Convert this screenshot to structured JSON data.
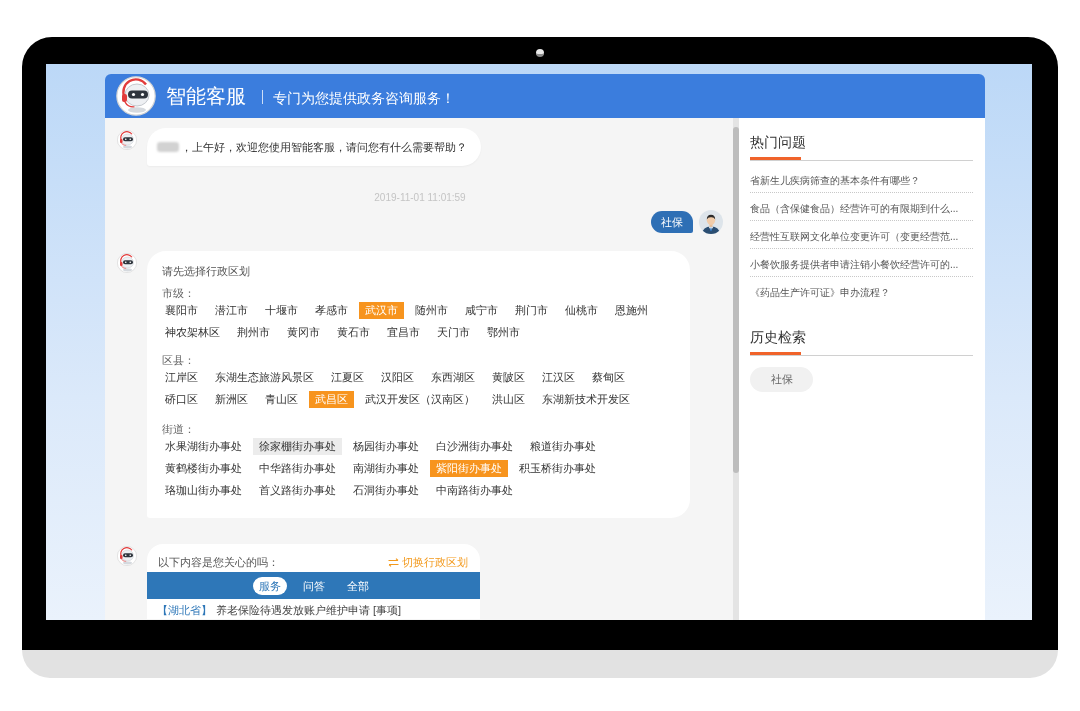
{
  "header": {
    "title": "智能客服",
    "subtitle": "专门为您提供政务咨询服务！"
  },
  "messages": [
    {
      "kind": "bot_text",
      "name_blurred": true,
      "text": "，上午好，欢迎您使用智能客服，请问您有什么需要帮助？"
    },
    {
      "kind": "timestamp",
      "text": "2019-11-01 11:01:59"
    },
    {
      "kind": "user_text",
      "text": "社保"
    },
    {
      "kind": "region_picker",
      "prompt": "请先选择行政区划",
      "groups": [
        {
          "label": "市级：",
          "options": [
            {
              "label": "襄阳市",
              "selected": false,
              "hovered": false
            },
            {
              "label": "潜江市",
              "selected": false,
              "hovered": false
            },
            {
              "label": "十堰市",
              "selected": false,
              "hovered": false
            },
            {
              "label": "孝感市",
              "selected": false,
              "hovered": false
            },
            {
              "label": "武汉市",
              "selected": true,
              "hovered": false
            },
            {
              "label": "随州市",
              "selected": false,
              "hovered": false
            },
            {
              "label": "咸宁市",
              "selected": false,
              "hovered": false
            },
            {
              "label": "荆门市",
              "selected": false,
              "hovered": false
            },
            {
              "label": "仙桃市",
              "selected": false,
              "hovered": false
            },
            {
              "label": "恩施州",
              "selected": false,
              "hovered": false
            },
            {
              "label": "神农架林区",
              "selected": false,
              "hovered": false
            },
            {
              "label": "荆州市",
              "selected": false,
              "hovered": false
            },
            {
              "label": "黄冈市",
              "selected": false,
              "hovered": false
            },
            {
              "label": "黄石市",
              "selected": false,
              "hovered": false
            },
            {
              "label": "宜昌市",
              "selected": false,
              "hovered": false
            },
            {
              "label": "天门市",
              "selected": false,
              "hovered": false
            },
            {
              "label": "鄂州市",
              "selected": false,
              "hovered": false
            }
          ]
        },
        {
          "label": "区县：",
          "options": [
            {
              "label": "江岸区",
              "selected": false,
              "hovered": false
            },
            {
              "label": "东湖生态旅游风景区",
              "selected": false,
              "hovered": false
            },
            {
              "label": "江夏区",
              "selected": false,
              "hovered": false
            },
            {
              "label": "汉阳区",
              "selected": false,
              "hovered": false
            },
            {
              "label": "东西湖区",
              "selected": false,
              "hovered": false
            },
            {
              "label": "黄陂区",
              "selected": false,
              "hovered": false
            },
            {
              "label": "江汉区",
              "selected": false,
              "hovered": false
            },
            {
              "label": "蔡甸区",
              "selected": false,
              "hovered": false
            },
            {
              "label": "硚口区",
              "selected": false,
              "hovered": false
            },
            {
              "label": "新洲区",
              "selected": false,
              "hovered": false
            },
            {
              "label": "青山区",
              "selected": false,
              "hovered": false
            },
            {
              "label": "武昌区",
              "selected": true,
              "hovered": false
            },
            {
              "label": "武汉开发区（汉南区）",
              "selected": false,
              "hovered": false
            },
            {
              "label": "洪山区",
              "selected": false,
              "hovered": false
            },
            {
              "label": "东湖新技术开发区",
              "selected": false,
              "hovered": false
            }
          ]
        },
        {
          "label": "街道：",
          "options": [
            {
              "label": "水果湖街办事处",
              "selected": false,
              "hovered": false
            },
            {
              "label": "徐家棚街办事处",
              "selected": false,
              "hovered": true
            },
            {
              "label": "杨园街办事处",
              "selected": false,
              "hovered": false
            },
            {
              "label": "白沙洲街办事处",
              "selected": false,
              "hovered": false
            },
            {
              "label": "粮道街办事处",
              "selected": false,
              "hovered": false
            },
            {
              "label": "黄鹤楼街办事处",
              "selected": false,
              "hovered": false
            },
            {
              "label": "中华路街办事处",
              "selected": false,
              "hovered": false
            },
            {
              "label": "南湖街办事处",
              "selected": false,
              "hovered": false
            },
            {
              "label": "紫阳街办事处",
              "selected": true,
              "hovered": false
            },
            {
              "label": "积玉桥街办事处",
              "selected": false,
              "hovered": false
            },
            {
              "label": "珞珈山街办事处",
              "selected": false,
              "hovered": false
            },
            {
              "label": "首义路街办事处",
              "selected": false,
              "hovered": false
            },
            {
              "label": "石洞街办事处",
              "selected": false,
              "hovered": false
            },
            {
              "label": "中南路街办事处",
              "selected": false,
              "hovered": false
            }
          ]
        }
      ]
    },
    {
      "kind": "suggestions",
      "prompt": "以下内容是您关心的吗：",
      "switch_link": "切换行政区划",
      "tabs": [
        {
          "label": "服务",
          "selected": true
        },
        {
          "label": "问答",
          "selected": false
        },
        {
          "label": "全部",
          "selected": false
        }
      ],
      "items": [
        {
          "region": "【湖北省】",
          "title": "养老保险待遇发放账户维护申请 [事项]"
        }
      ]
    }
  ],
  "sidebar": {
    "sections": [
      {
        "kind": "links",
        "title": "热门问题",
        "items": [
          "省新生儿疾病筛查的基本条件有哪些？",
          "食品（含保健食品）经营许可的有限期到什么...",
          "经营性互联网文化单位变更许可（变更经营范...",
          "小餐饮服务提供者申请注销小餐饮经营许可的...",
          "《药品生产许可证》申办流程？"
        ]
      },
      {
        "kind": "chips",
        "title": "历史检索",
        "items": [
          "社保"
        ]
      }
    ]
  }
}
